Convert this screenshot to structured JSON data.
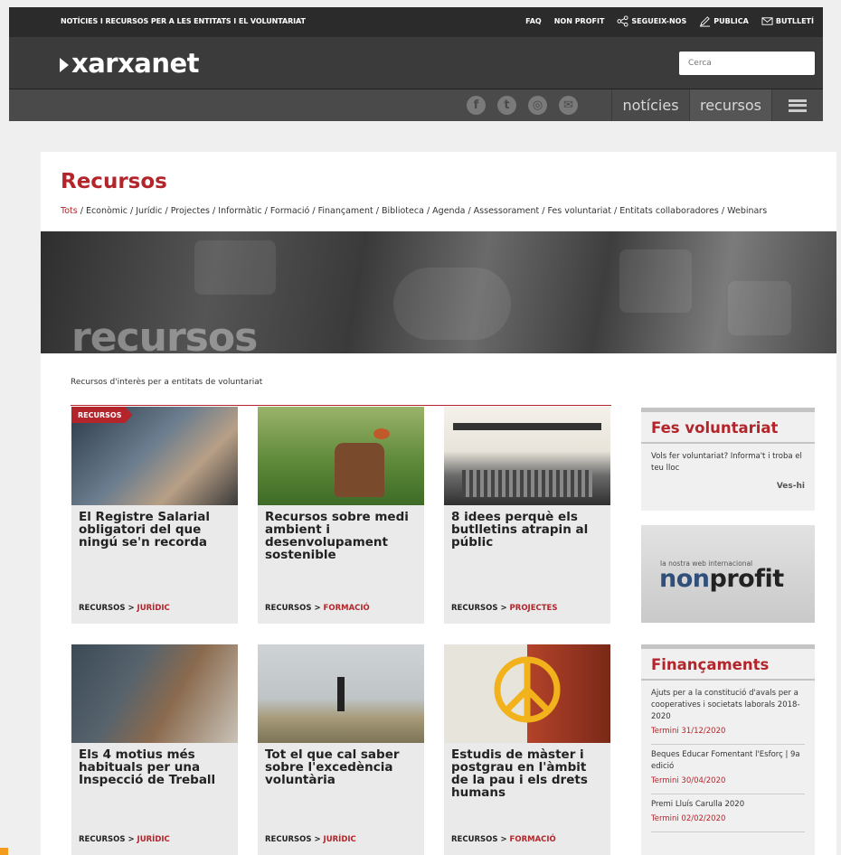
{
  "topbar": {
    "tagline": "NOTÍCIES I RECURSOS PER A LES ENTITATS I EL VOLUNTARIAT",
    "links": [
      "FAQ",
      "NON PROFIT",
      "SEGUEIX-NOS",
      "PUBLICA",
      "BUTLLETÍ"
    ]
  },
  "header": {
    "logo": "xarxanet",
    "search_placeholder": "Cerca"
  },
  "nav": {
    "social": [
      "f",
      "t",
      "◎",
      "✉"
    ],
    "tabs": [
      "notícies",
      "recursos"
    ]
  },
  "page": {
    "title": "Recursos",
    "filters": [
      "Tots",
      "Econòmic",
      "Jurídic",
      "Projectes",
      "Informàtic",
      "Formació",
      "Finançament",
      "Biblioteca",
      "Agenda",
      "Assessorament",
      "Fes voluntariat",
      "Entitats collaboradores",
      "Webinars"
    ],
    "banner_word": "recursos",
    "intro": "Recursos d'interès per a entitats de voluntariat",
    "badge": "RECURSOS",
    "category_prefix": "RECURSOS > "
  },
  "cards": [
    {
      "title": "El Registre Salarial obligatori del que ningú se'n recorda",
      "category": "JURÍDIC"
    },
    {
      "title": "Recursos sobre medi ambient i desenvolupament sostenible",
      "category": "FORMACIÓ"
    },
    {
      "title": "8 idees perquè els butlletins atrapin al públic",
      "category": "PROJECTES"
    },
    {
      "title": "Els 4 motius més habituals per una Inspecció de Treball",
      "category": "JURÍDIC"
    },
    {
      "title": "Tot el que cal saber sobre l'excedència voluntària",
      "category": "JURÍDIC"
    },
    {
      "title": "Estudis de màster i postgrau en l'àmbit de la pau i els drets humans",
      "category": "FORMACIÓ"
    }
  ],
  "sidebar": {
    "volunteer": {
      "title": "Fes voluntariat",
      "text": "Vols fer voluntariat? Informa't i troba el teu lloc",
      "more": "Ves-hi"
    },
    "nonprofit": {
      "small": "la nostra web internacional",
      "word_a": "non",
      "word_b": "profit"
    },
    "funding": {
      "title": "Finançaments",
      "items": [
        {
          "text": "Ajuts per a la constitució d'avals per a cooperatives i societats laborals 2018-2020",
          "deadline": "Termini 31/12/2020"
        },
        {
          "text": "Beques Educar Fomentant l'Esforç | 9a edició",
          "deadline": "Termini 30/04/2020"
        },
        {
          "text": "Premi Lluís Carulla 2020",
          "deadline": "Termini 02/02/2020"
        }
      ]
    }
  },
  "colors": {
    "accent": "#b3252b",
    "topbar": "#2b2b2b",
    "navbar": "#4a4a4a"
  }
}
